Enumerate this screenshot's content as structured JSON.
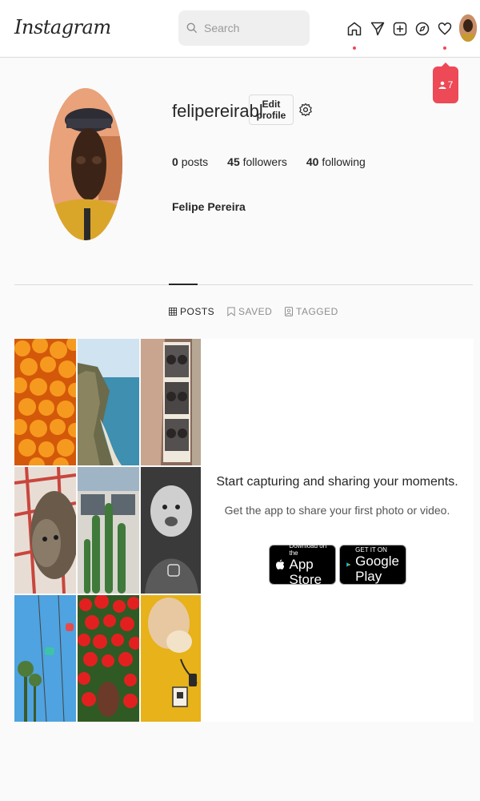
{
  "header": {
    "logo": "Instagram",
    "search_placeholder": "Search"
  },
  "notifications": {
    "count": "7"
  },
  "profile": {
    "username": "felipereirabl",
    "edit_label": "Edit profile",
    "posts_count": "0",
    "posts_label": "posts",
    "followers_count": "45",
    "followers_label": "followers",
    "following_count": "40",
    "following_label": "following",
    "full_name": "Felipe Pereira"
  },
  "tabs": [
    {
      "label": "POSTS",
      "active": true
    },
    {
      "label": "SAVED",
      "active": false
    },
    {
      "label": "TAGGED",
      "active": false
    }
  ],
  "empty_state": {
    "title": "Start capturing and sharing your moments.",
    "subtitle": "Get the app to share your first photo or video.",
    "app_store_small": "Download on the",
    "app_store_big": "App Store",
    "google_play_small": "GET IT ON",
    "google_play_big": "Google Play"
  },
  "colors": {
    "accent_red": "#ed4956",
    "text": "#262626",
    "border": "#dbdbdb"
  }
}
